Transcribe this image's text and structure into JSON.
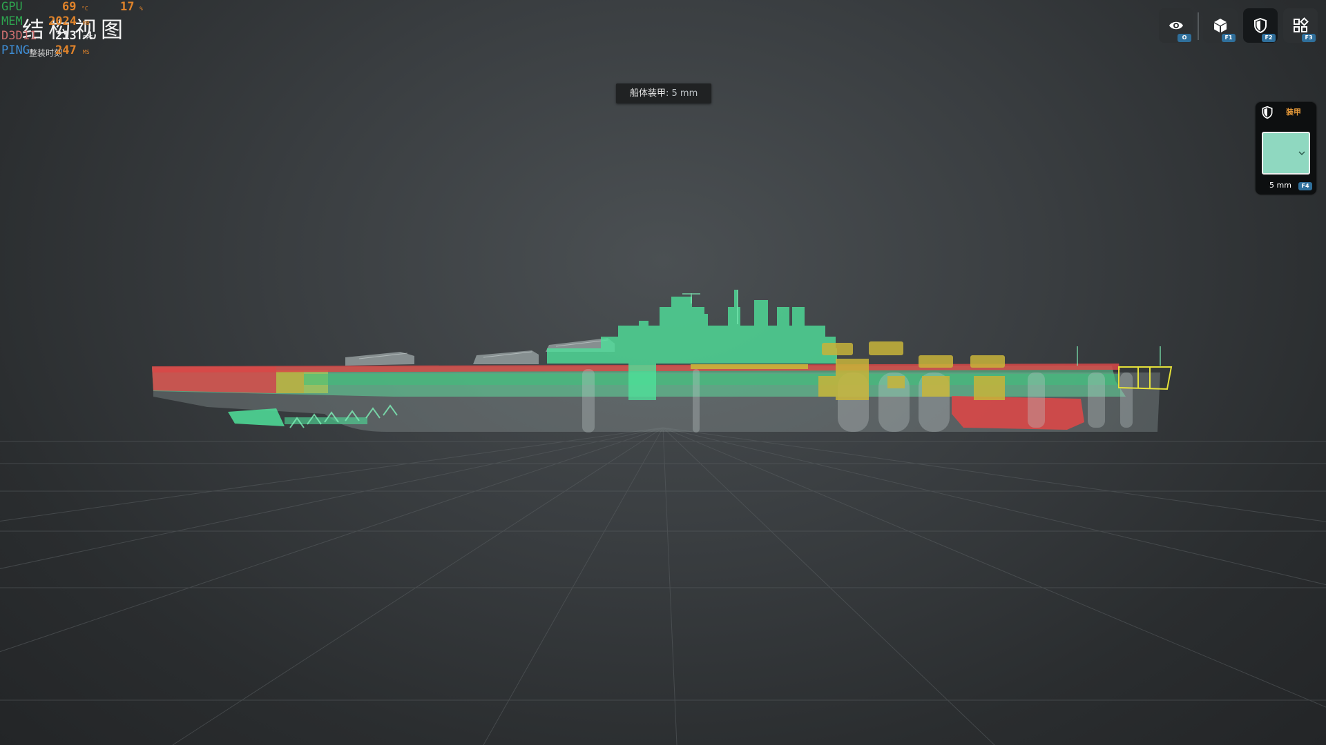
{
  "perf": {
    "gpu_label": "GPU",
    "gpu_temp": "69",
    "gpu_temp_unit": "°C",
    "gpu_load": "17",
    "gpu_load_unit": "%",
    "mem_label": "MEM",
    "mem_value": "2024",
    "mem_unit": "MB",
    "d3d_label": "D3D11",
    "fps_value": "213",
    "fps_unit": "FPS",
    "ping_label": "PING",
    "ping_value": "247",
    "ping_unit": "MS"
  },
  "page": {
    "title": "结构视图",
    "subtitle": "整装时刻"
  },
  "tooltip": {
    "label": "船体装甲",
    "value": ": 5 mm"
  },
  "toolbar": {
    "buttons": [
      {
        "icon": "eye-icon",
        "key": "O",
        "active": false
      },
      {
        "icon": "cube-icon",
        "key": "F1",
        "active": false
      },
      {
        "icon": "shield-icon",
        "key": "F2",
        "active": true
      },
      {
        "icon": "grid-icon",
        "key": "F3",
        "active": false
      }
    ]
  },
  "armor_panel": {
    "title": "装甲",
    "value": "5 mm",
    "key": "F4",
    "swatch_color": "#8fd8c0"
  },
  "colors": {
    "armor_thin": "#5fd89a",
    "armor_mid": "#c8b43a",
    "armor_thick": "#d94848",
    "armor_selected_outline": "#e6e23a"
  }
}
